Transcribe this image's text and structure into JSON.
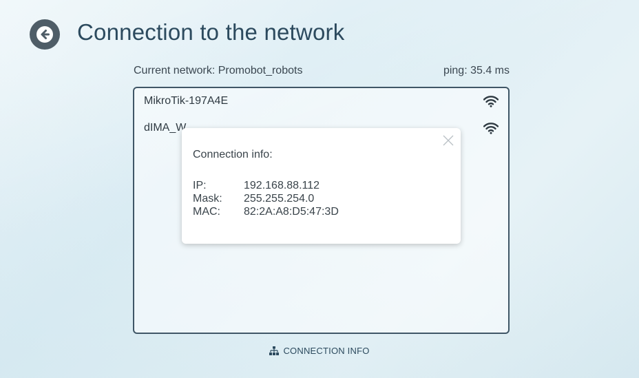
{
  "header": {
    "title": "Connection to the network",
    "back_icon": "arrow-left-circle-icon"
  },
  "status": {
    "current_network": "Current network: Promobot_robots",
    "ping": "ping: 35.4 ms"
  },
  "networks": [
    {
      "ssid": "MikroTik-197A4E",
      "icon": "wifi-icon"
    },
    {
      "ssid": "dIMA_W",
      "icon": "wifi-icon"
    }
  ],
  "modal": {
    "title": "Connection info:",
    "rows": [
      {
        "label": "IP:",
        "value": "192.168.88.112"
      },
      {
        "label": "Mask:",
        "value": "255.255.254.0"
      },
      {
        "label": "MAC:",
        "value": "82:2A:A8:D5:47:3D"
      }
    ],
    "close_icon": "close-icon"
  },
  "footer": {
    "action_label": "CONNECTION INFO",
    "action_icon": "network-icon"
  },
  "colors": {
    "accent": "#2c4a5e",
    "back_button": "#4f5d67",
    "list_border": "#3f5666"
  }
}
